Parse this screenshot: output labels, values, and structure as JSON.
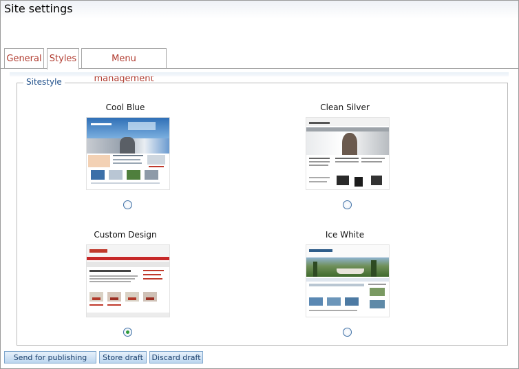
{
  "page": {
    "title": "Site settings"
  },
  "tabs": [
    {
      "label": "General"
    },
    {
      "label": "Styles"
    },
    {
      "label": "Menu management"
    }
  ],
  "fieldset": {
    "legend": "Sitestyle"
  },
  "styles": [
    {
      "label": "Cool Blue",
      "selected": false
    },
    {
      "label": "Clean Silver",
      "selected": false
    },
    {
      "label": "Custom Design",
      "selected": true
    },
    {
      "label": "Ice White",
      "selected": false
    }
  ],
  "buttons": {
    "publish": "Send for publishing",
    "store": "Store draft",
    "discard": "Discard draft"
  },
  "colors": {
    "tab_text": "#b03a2e",
    "legend_text": "#1f4f8a",
    "button_border": "#7fa6cc",
    "radio_checked": "#2f9b3a"
  }
}
